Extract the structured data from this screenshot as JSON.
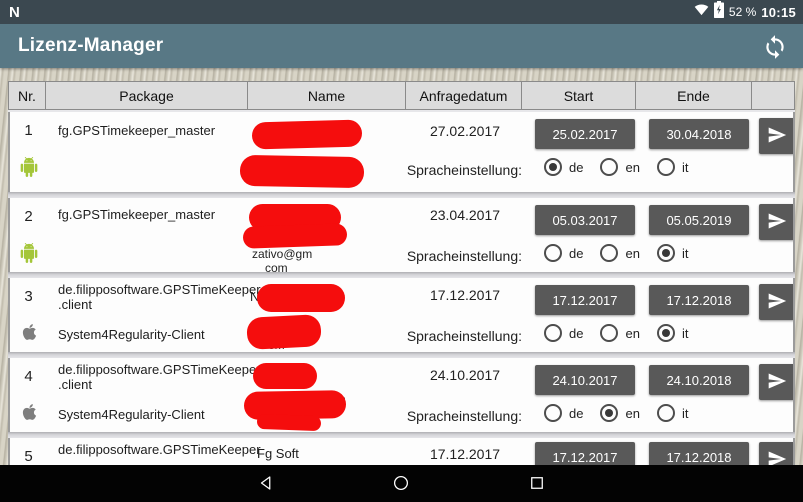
{
  "status_bar": {
    "battery_percent": "52 %",
    "time": "10:15",
    "n_logo": "N"
  },
  "toolbar": {
    "title": "Lizenz-Manager"
  },
  "table": {
    "headers": {
      "nr": "Nr.",
      "package": "Package",
      "name": "Name",
      "anfragedatum": "Anfragedatum",
      "start": "Start",
      "ende": "Ende",
      "actions": ""
    },
    "language_label": "Spracheinstellung:",
    "lang_de": "de",
    "lang_en": "en",
    "lang_it": "it",
    "rows": [
      {
        "nr": "1",
        "platform": "android",
        "package": "fg.GPSTimekeeper_master",
        "anfragedatum": "27.02.2017",
        "start": "25.02.2017",
        "ende": "30.04.2018",
        "language": "de"
      },
      {
        "nr": "2",
        "platform": "android",
        "package": "fg.GPSTimekeeper_master",
        "anfragedatum": "23.04.2017",
        "start": "05.03.2017",
        "ende": "05.05.2019",
        "language": "it",
        "email_fragment": "zativo@gm",
        "email_fragment2": "com"
      },
      {
        "nr": "3",
        "platform": "apple",
        "package_line1": "de.filipposoftware.GPSTimeKeeper",
        "package_line2": ".client",
        "client_name": "System4Regularity-Client",
        "anfragedatum": "17.12.2017",
        "start": "17.12.2017",
        "ende": "17.12.2018",
        "language": "it",
        "name_fragment": "N",
        "email_fragment": "om"
      },
      {
        "nr": "4",
        "platform": "apple",
        "package_line1": "de.filipposoftware.GPSTimeKeeper",
        "package_line2": ".client",
        "client_name": "System4Regularity-Client",
        "anfragedatum": "24.10.2017",
        "start": "24.10.2017",
        "ende": "24.10.2018",
        "language": "en",
        "email_fragment": "il"
      },
      {
        "nr": "5",
        "package": "de.filipposoftware.GPSTimeKeeper",
        "name": "Fg Soft",
        "anfragedatum": "17.12.2017",
        "start": "17.12.2017",
        "ende": "17.12.2018"
      }
    ]
  },
  "colors": {
    "status_bar": "#3b4850",
    "toolbar": "#587885",
    "button_gray": "#595959",
    "android_green": "#a4c639",
    "apple_gray": "#7e7e7e",
    "redaction_red": "#f50d0d"
  }
}
